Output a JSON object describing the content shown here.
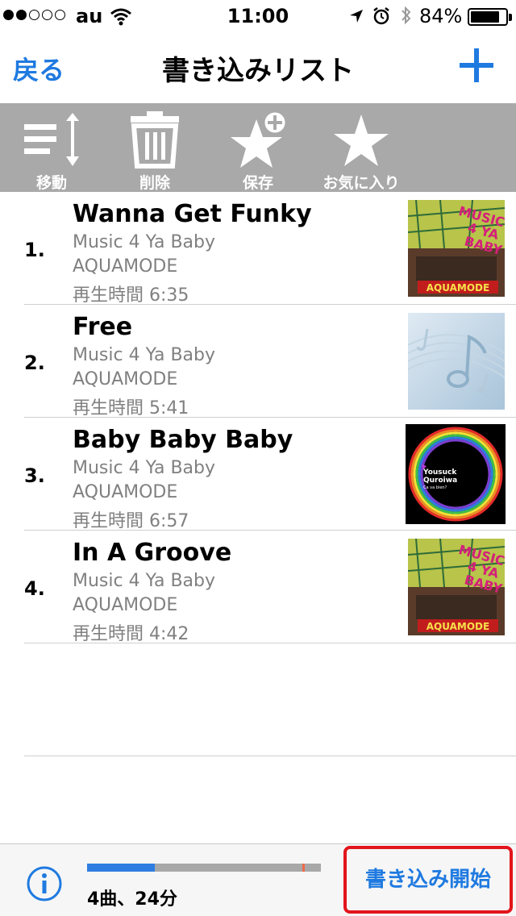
{
  "status_bar": {
    "carrier": "au",
    "time": "11:00",
    "battery_percent": "84%",
    "battery_level": 0.84,
    "signal_bars_filled": 2,
    "signal_bars_total": 5
  },
  "nav": {
    "back_label": "戻る",
    "title": "書き込みリスト",
    "add_icon": "plus-icon"
  },
  "toolbar": {
    "items": [
      {
        "label": "移動",
        "icon": "reorder-icon"
      },
      {
        "label": "削除",
        "icon": "trash-icon"
      },
      {
        "label": "保存",
        "icon": "star-plus-icon"
      },
      {
        "label": "お気に入り",
        "icon": "star-icon"
      }
    ]
  },
  "tracks": [
    {
      "number": "1.",
      "title": "Wanna Get Funky",
      "album": "Music 4 Ya Baby",
      "artist": "AQUAMODE",
      "duration": "再生時間 6:35"
    },
    {
      "number": "2.",
      "title": "Free",
      "album": "Music 4 Ya Baby",
      "artist": "AQUAMODE",
      "duration": "再生時間 5:41"
    },
    {
      "number": "3.",
      "title": "Baby Baby Baby",
      "album": "Music 4 Ya Baby",
      "artist": "AQUAMODE",
      "duration": "再生時間 6:57"
    },
    {
      "number": "4.",
      "title": "In A Groove",
      "album": "Music 4 Ya Baby",
      "artist": "AQUAMODE",
      "duration": "再生時間 4:42"
    }
  ],
  "artwork": {
    "aquamode_cover": {
      "line1": "MUSIC",
      "line2": "4 YA",
      "line3": "BABY",
      "brand": "AQUAMODE"
    },
    "ring_cover": {
      "artist": "Yousuck",
      "artist2": "Quroiwa",
      "subtitle": "Ca va bien?"
    }
  },
  "bottom_bar": {
    "info_icon": "info-icon",
    "summary": "4曲、24分",
    "progress": 0.29,
    "marker": 0.92,
    "start_label": "書き込み開始"
  },
  "colors": {
    "accent": "#1f7ae0",
    "toolbar_bg": "#a9a9a9",
    "highlight_border": "#e2141c"
  }
}
